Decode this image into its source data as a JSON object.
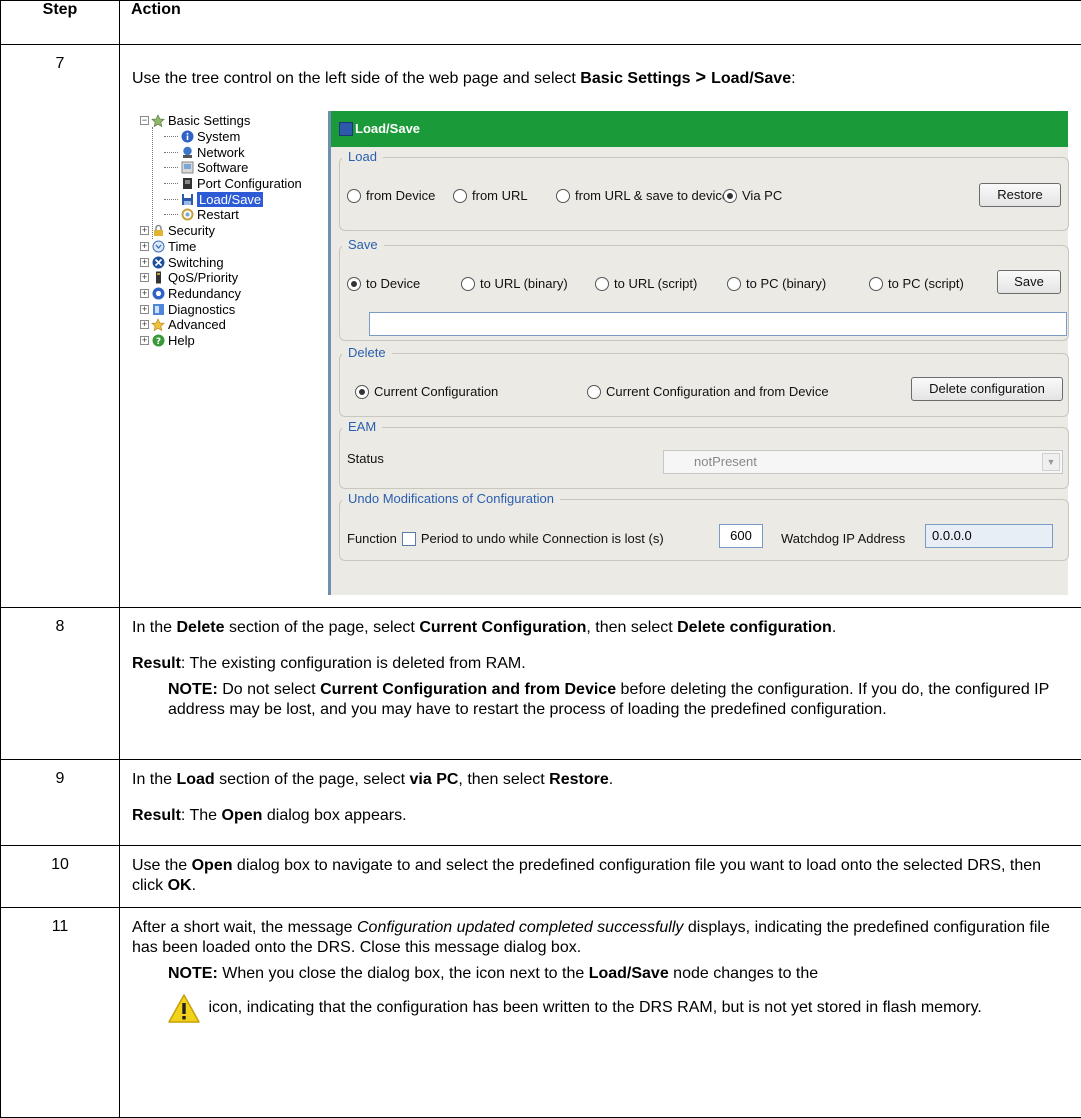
{
  "header": {
    "step": "Step",
    "action": "Action"
  },
  "step7": {
    "num": "7",
    "text_pre": "Use the tree control on the left side of the web page and select ",
    "b1": "Basic Settings",
    "arrow": " > ",
    "b2": "Load/Save",
    "text_post": ":"
  },
  "tree": {
    "basic_settings": "Basic Settings",
    "children": [
      "System",
      "Network",
      "Software",
      "Port Configuration",
      "Load/Save",
      "Restart"
    ],
    "groups": [
      "Security",
      "Time",
      "Switching",
      "QoS/Priority",
      "Redundancy",
      "Diagnostics",
      "Advanced",
      "Help"
    ]
  },
  "panel": {
    "title": "Load/Save",
    "load": {
      "legend": "Load",
      "options": [
        "from Device",
        "from URL",
        "from URL & save to device",
        "Via PC"
      ],
      "selected": "Via PC",
      "button": "Restore"
    },
    "save": {
      "legend": "Save",
      "options": [
        "to Device",
        "to URL (binary)",
        "to URL (script)",
        "to PC (binary)",
        "to PC (script)"
      ],
      "selected": "to Device",
      "button": "Save",
      "url_value": ""
    },
    "delete": {
      "legend": "Delete",
      "options": [
        "Current Configuration",
        "Current Configuration and from Device"
      ],
      "selected": "Current Configuration",
      "button": "Delete configuration"
    },
    "eam": {
      "legend": "EAM",
      "status_label": "Status",
      "status_value": "notPresent"
    },
    "undo": {
      "legend": "Undo Modifications of Configuration",
      "function_label": "Function",
      "checkbox_label": "Period to undo while Connection is lost (s)",
      "period_value": "600",
      "watchdog_label": "Watchdog IP Address",
      "watchdog_value": "0.0.0.0"
    },
    "colors": {
      "title_bar": "#1b9a3a",
      "legend": "#2a5fb0",
      "selection": "#2d5bd6"
    }
  },
  "step8": {
    "num": "8",
    "l1_a": "In the ",
    "l1_b1": "Delete",
    "l1_c": " section of the page, select ",
    "l1_b2": "Current Configuration",
    "l1_d": ", then select ",
    "l1_b3": "Delete configuration",
    "l1_e": ".",
    "result_label": "Result",
    "result_text": ": The existing configuration is deleted from RAM.",
    "note_label": "NOTE:",
    "note_a": " Do not select ",
    "note_b": "Current Configuration and from Device",
    "note_c": " before deleting the configuration. If you do, the configured IP address may be lost, and you may have to restart the process of loading the predefined configuration."
  },
  "step9": {
    "num": "9",
    "l1_a": "In the ",
    "l1_b1": "Load",
    "l1_c": " section of the page, select ",
    "l1_b2": "via PC",
    "l1_d": ", then select ",
    "l1_b3": "Restore",
    "l1_e": ".",
    "result_label": "Result",
    "result_a": ": The ",
    "result_b": "Open",
    "result_c": " dialog box appears."
  },
  "step10": {
    "num": "10",
    "a": "Use the ",
    "b1": "Open",
    "c": " dialog box to navigate to and select the predefined configuration file you want to load onto the selected DRS, then click ",
    "b2": "OK",
    "d": "."
  },
  "step11": {
    "num": "11",
    "a": "After a short wait, the message ",
    "i1": "Configuration updated completed successfully",
    "b": " displays, indicating the predefined configuration file has been loaded onto the DRS. Close this message dialog box.",
    "note_label": "NOTE:",
    "note_a": " When you close the dialog box, the icon next to the ",
    "note_b": "Load/Save",
    "note_c": " node changes to the",
    "note_d": " icon, indicating that the configuration has been written to the DRS RAM, but is not yet stored in flash memory.",
    "icon": "warning-icon"
  }
}
